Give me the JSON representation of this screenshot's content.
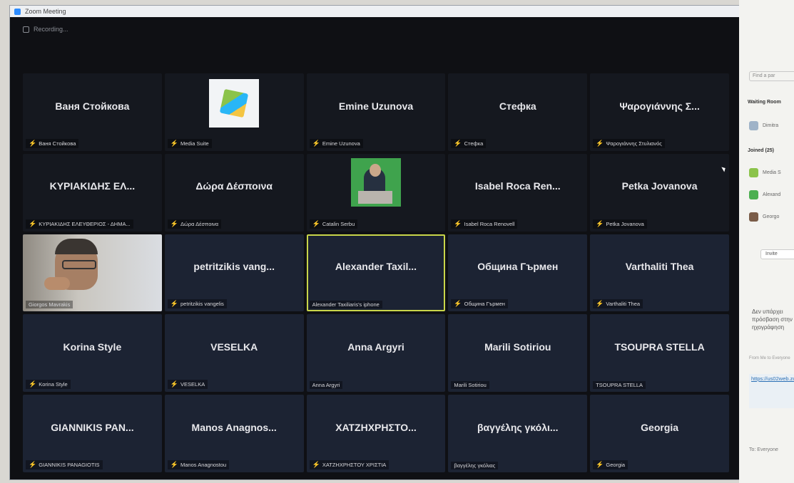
{
  "window": {
    "title": "Zoom Meeting",
    "recording": "Recording..."
  },
  "tiles": [
    {
      "name": "Ваня Стойкова",
      "label": "Ваня Стойкова"
    },
    {
      "name": "",
      "label": "Media Suite"
    },
    {
      "name": "Emine Uzunova",
      "label": "Emine Uzunova"
    },
    {
      "name": "Стефка",
      "label": "Стефка"
    },
    {
      "name": "Ψαρογιάννης Σ...",
      "label": "Ψαρογιάννης Στυλιανός"
    },
    {
      "name": "ΚΥΡΙΑΚΙΔΗΣ ΕΛ...",
      "label": "ΚΥΡΙΑΚΙΔΗΣ ΕΛΕΥΘΕΡΙΟΣ - ΔΗΜΑ..."
    },
    {
      "name": "Δώρα Δέσποινα",
      "label": "Δώρα Δέσποινα"
    },
    {
      "name": "",
      "label": "Catalin Serbu"
    },
    {
      "name": "Isabel Roca Ren...",
      "label": "Isabel Roca Renovell"
    },
    {
      "name": "Petka Jovanova",
      "label": "Petka Jovanova"
    },
    {
      "name": "",
      "label": "Giorgos Mavrakis"
    },
    {
      "name": "petritzikis vang...",
      "label": "petritzikis vangelis"
    },
    {
      "name": "Alexander Taxil...",
      "label": "Alexander Taxiliaris's iphone"
    },
    {
      "name": "Община Гърмен",
      "label": "Община Гърмен"
    },
    {
      "name": "Varthaliti Thea",
      "label": "Varthaliti Thea"
    },
    {
      "name": "Korina Style",
      "label": "Korina Style"
    },
    {
      "name": "VESELKA",
      "label": "VESELKA"
    },
    {
      "name": "Anna Argyri",
      "label": "Anna Argyri"
    },
    {
      "name": "Marili Sotiriou",
      "label": "Marili Sotiriou"
    },
    {
      "name": "TSOUPRA STELLA",
      "label": "TSOUPRA STELLA"
    },
    {
      "name": "GIANNIKIS PAN...",
      "label": "GIANNIKIS PANAGIOTIS"
    },
    {
      "name": "Manos Anagnos...",
      "label": "Manos Anagnostou"
    },
    {
      "name": "ΧΑΤΖΗΧΡΗΣΤΟ...",
      "label": "ΧΑΤΖΗΧΡΗΣΤΟΥ ΧΡΙΣΤΙΑ"
    },
    {
      "name": "βαγγέλης γκόλι...",
      "label": "βαγγέλης γκόλιας"
    },
    {
      "name": "Georgia",
      "label": "Georgia"
    }
  ],
  "sidebar": {
    "search_placeholder": "Find a par",
    "waiting_room": "Waiting Room",
    "waiting_user": "Dimitra",
    "joined": "Joined (25)",
    "rows": [
      "Media S",
      "Alexand",
      "Georgo"
    ],
    "button": "Invite",
    "chat": "Δεν υπάρχει πρόσβαση στην ηχογράφηση",
    "chat_meta": "From Me to Everyone",
    "link": "https://us02web.zoom.us/j/8",
    "to": "To: Everyone"
  }
}
